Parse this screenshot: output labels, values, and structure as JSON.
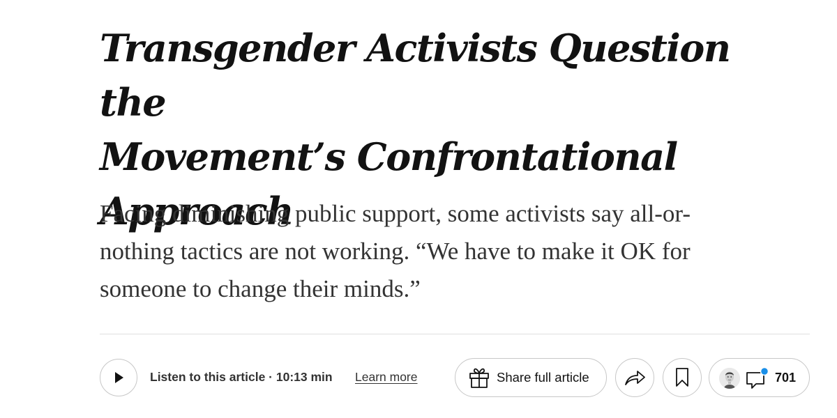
{
  "article": {
    "headline_line1": "Transgender Activists Question the",
    "headline_line2": "Movement’s Confrontational",
    "headline_line3": "Approach",
    "summary_line1": "Facing diminishing public support, some activists say all-or-",
    "summary_line2": "nothing tactics are not working. “We have to make it OK for",
    "summary_line3": "someone to change their minds.”"
  },
  "toolbar": {
    "play_icon": "play-icon",
    "listen_label": "Listen to this article · 10:13 min",
    "learn_more_label": "Learn more",
    "share_icon": "gift-icon",
    "share_label": "Share full article",
    "forward_icon": "share-arrow-icon",
    "save_icon": "bookmark-icon",
    "comment_icon": "comment-bubble-icon",
    "comment_count": "701",
    "notification_dot_color": "#1a8fe8"
  }
}
